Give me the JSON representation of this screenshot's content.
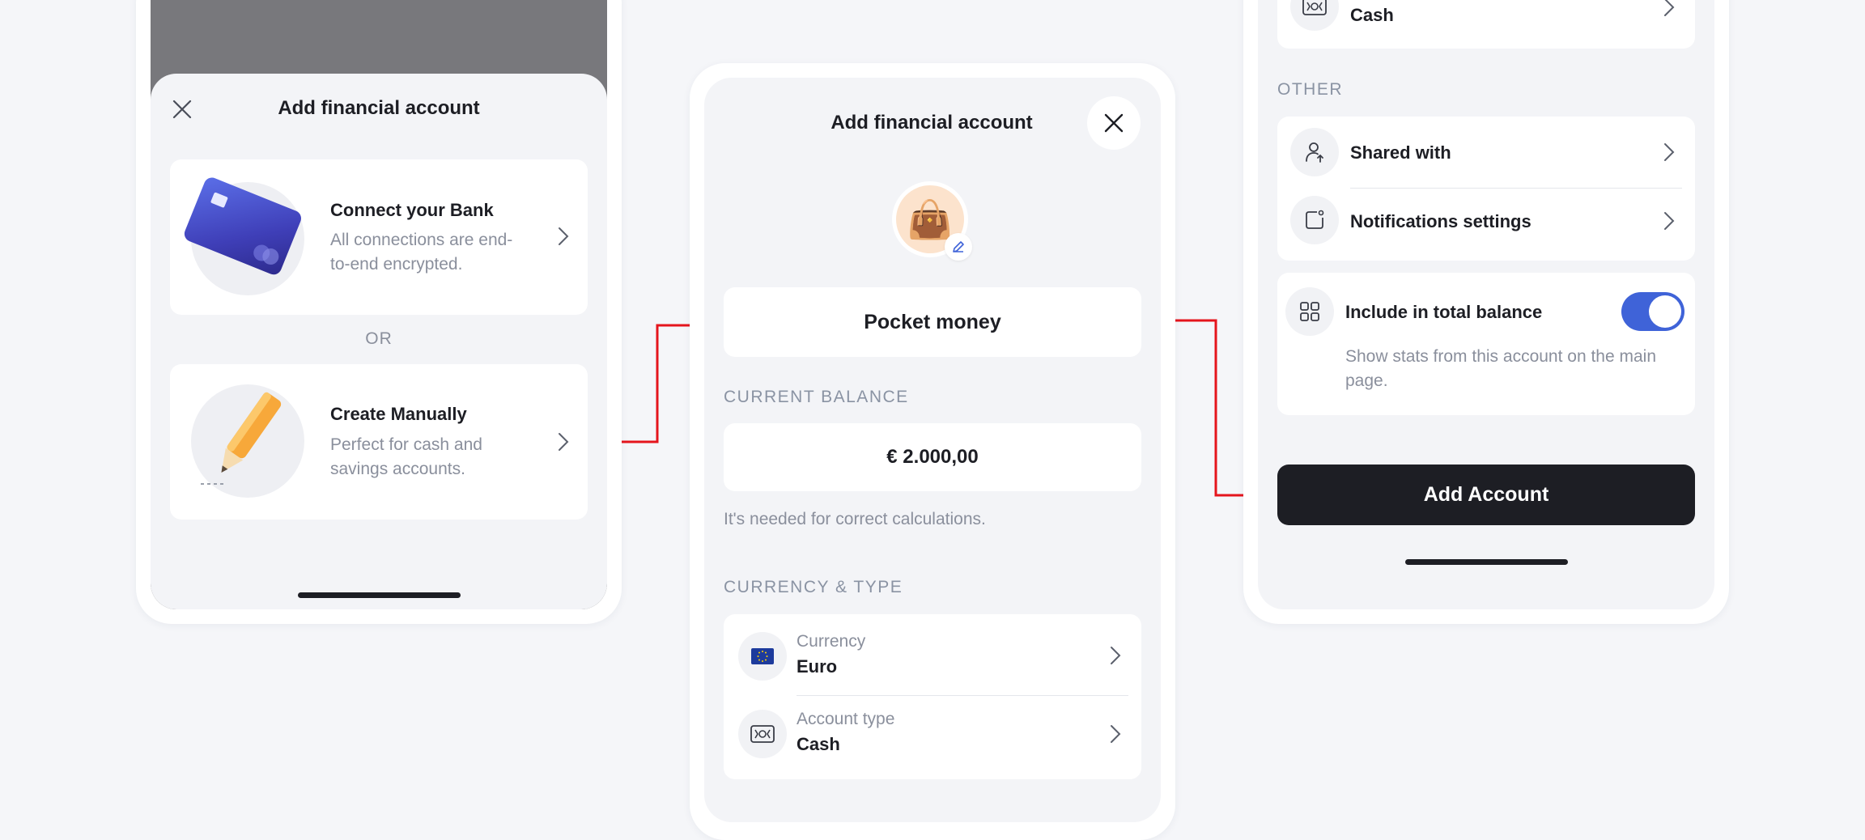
{
  "colors": {
    "background": "#f5f6f9",
    "accent": "#3f63d8",
    "arrow": "#e5151d",
    "dark_button": "#1d1e24"
  },
  "screen1": {
    "title": "Add financial account",
    "bank": {
      "title": "Connect your Bank",
      "subtitle_line1": "All connections are end-",
      "subtitle_line2": "to-end encrypted."
    },
    "or_label": "OR",
    "manual": {
      "title": "Create Manually",
      "subtitle_line1": "Perfect for cash and",
      "subtitle_line2": "savings accounts."
    }
  },
  "screen2": {
    "title": "Add financial account",
    "account_emoji": "👜",
    "account_name": "Pocket money",
    "balance_section": "CURRENT BALANCE",
    "balance_value": "€ 2.000,00",
    "balance_hint": "It's needed for correct calculations.",
    "currency_section": "CURRENCY & TYPE",
    "currency": {
      "label": "Currency",
      "value": "Euro"
    },
    "account_type": {
      "label": "Account type",
      "value": "Cash"
    }
  },
  "screen3": {
    "top_row_value": "Cash",
    "other_section": "OTHER",
    "shared_with": "Shared with",
    "notifications": "Notifications settings",
    "include_title": "Include in total balance",
    "include_desc_line1": "Show stats from this account on the main",
    "include_desc_line2": "page.",
    "include_enabled": true,
    "add_button": "Add Account"
  }
}
